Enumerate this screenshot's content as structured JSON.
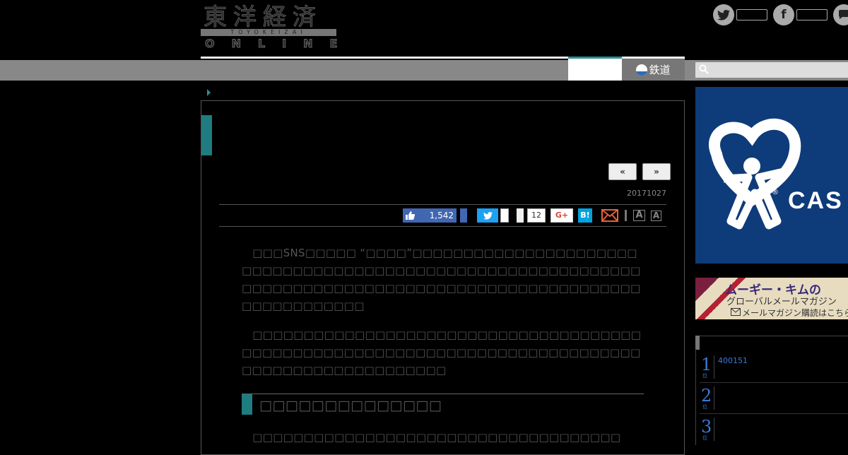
{
  "header": {
    "logo_kanji": "東洋経済",
    "logo_romaji": "TOYOKEIZAI",
    "logo_online": "ONLINE"
  },
  "social": {
    "twitter_icon": "twitter-icon",
    "facebook_icon": "facebook-icon",
    "comment_icon": "comment-icon"
  },
  "nav": {
    "rail_label": "鉄道",
    "search_placeholder": ""
  },
  "article": {
    "prev_label": "«",
    "next_label": "»",
    "date": "20171027",
    "share": {
      "fb_count": "1,542",
      "pocket_count": "12",
      "gplus_label": "G+",
      "hatena_label": "B!"
    },
    "font_large": "A",
    "font_small": "A",
    "paragraphs": [
      "　□□□SNS□□□□□ “□□□□”□□□□□□□□□□□□□□□□□□□□□□□□□□□□□□□□□□□□□□□□□□□□□□□□□□□□□□□□□□□□□□□□□□□□□□□□□□□□□□□□□□□□□□□□□□□□□□□□□□□□□□□□□□□□□□□□",
      "　□□□□□□□□□□□□□□□□□□□□□□□□□□□□□□□□□□□□□□□□□□□□□□□□□□□□□□□□□□□□□□□□□□□□□□□□□□□□□□□□□□□□□□□□□□□□□□□□□",
      "　□□□□□□□□□□□□□□□□□□□□□□□□□□□□□□□□□□□□"
    ],
    "heading": "□□□□□□□□□□□□□□"
  },
  "sidebar": {
    "ad_brand": "CAS",
    "mook_title": "ムーギー・キムの",
    "mook_sub": "グローバルメールマガジン",
    "mook_cta": "メールマガジン購読はこちら",
    "ranking": [
      {
        "rank": "1",
        "suffix": "位",
        "text": "400151"
      },
      {
        "rank": "2",
        "suffix": "位",
        "text": ""
      },
      {
        "rank": "3",
        "suffix": "位",
        "text": ""
      }
    ]
  },
  "colors": {
    "accent_teal": "#1f7c80",
    "facebook": "#4267b2",
    "twitter": "#1da1f2",
    "hatena": "#00a4de",
    "rank_blue": "#3a7bd5"
  }
}
